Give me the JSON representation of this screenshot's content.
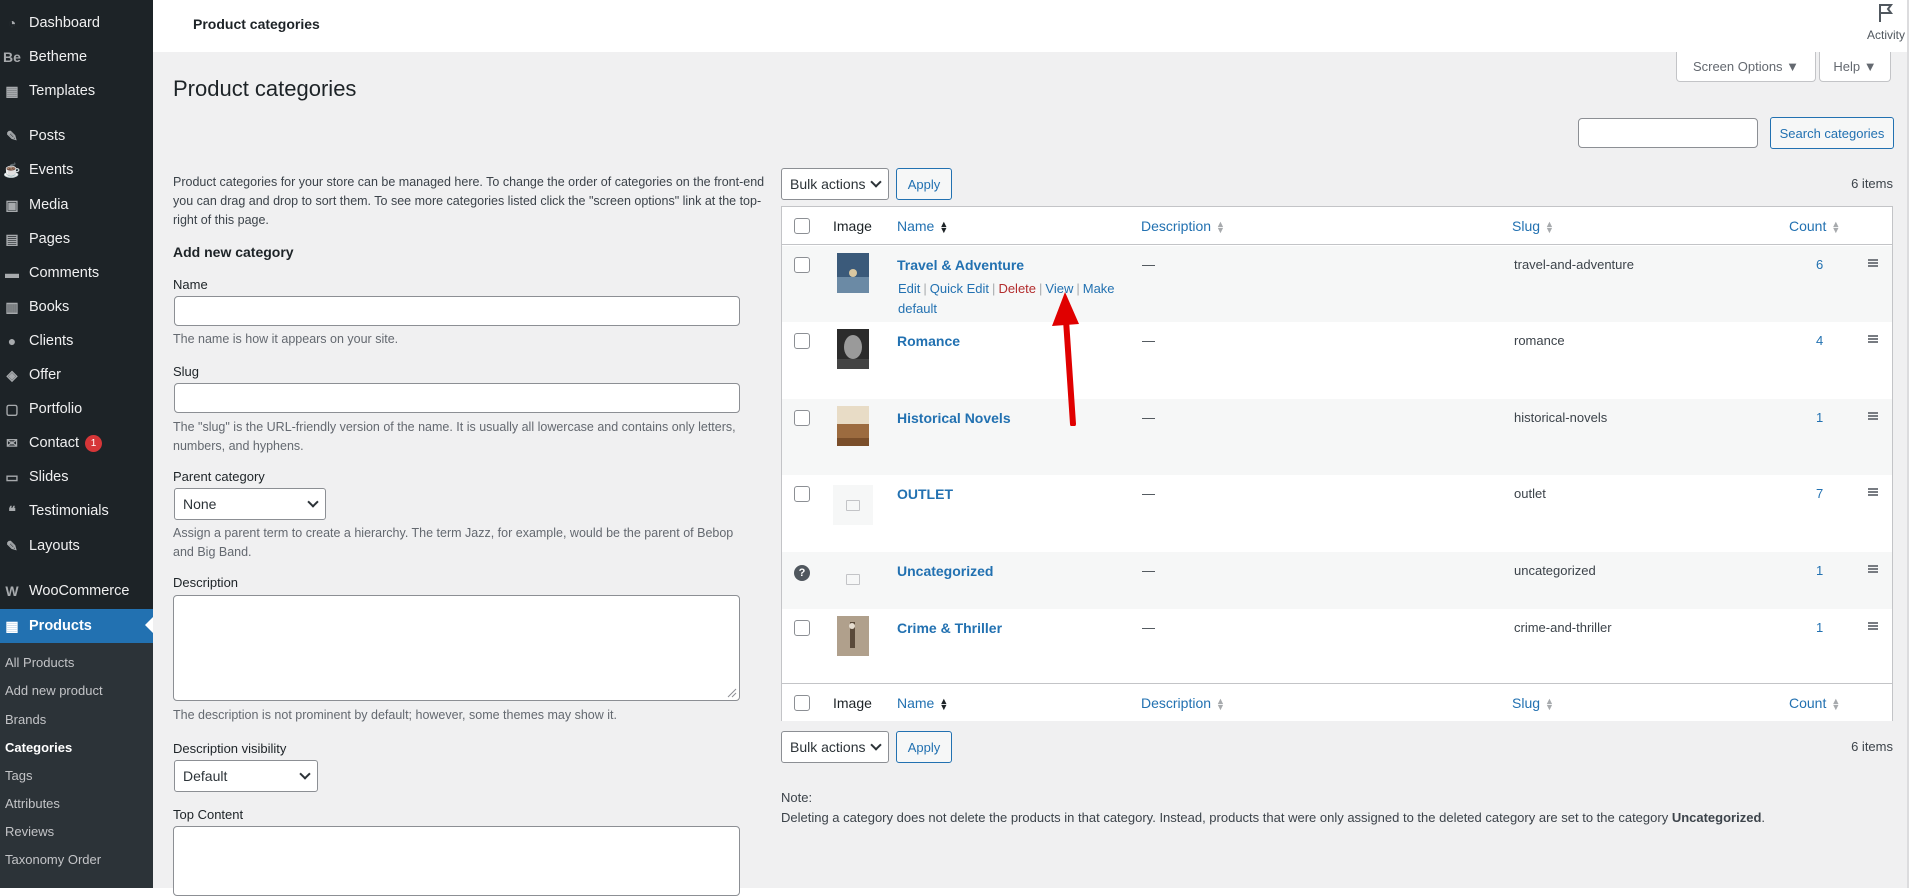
{
  "sidebar": {
    "items": [
      {
        "label": "Dashboard",
        "icon": "dashboard-icon"
      },
      {
        "label": "Betheme",
        "icon": "betheme-icon"
      },
      {
        "label": "Templates",
        "icon": "templates-icon"
      },
      {
        "label": "Posts",
        "icon": "pin-icon"
      },
      {
        "label": "Events",
        "icon": "events-icon"
      },
      {
        "label": "Media",
        "icon": "media-icon"
      },
      {
        "label": "Pages",
        "icon": "pages-icon"
      },
      {
        "label": "Comments",
        "icon": "comments-icon"
      },
      {
        "label": "Books",
        "icon": "books-icon"
      },
      {
        "label": "Clients",
        "icon": "clients-icon"
      },
      {
        "label": "Offer",
        "icon": "tag-icon"
      },
      {
        "label": "Portfolio",
        "icon": "portfolio-icon"
      },
      {
        "label": "Contact",
        "icon": "mail-icon",
        "badge": "1"
      },
      {
        "label": "Slides",
        "icon": "slides-icon"
      },
      {
        "label": "Testimonials",
        "icon": "testimonials-icon"
      },
      {
        "label": "Layouts",
        "icon": "layouts-icon"
      },
      {
        "label": "WooCommerce",
        "icon": "woocommerce-icon"
      },
      {
        "label": "Products",
        "icon": "products-icon"
      }
    ],
    "submenu": [
      "All Products",
      "Add new product",
      "Brands",
      "Categories",
      "Tags",
      "Attributes",
      "Reviews",
      "Taxonomy Order"
    ]
  },
  "header": {
    "title": "Product categories",
    "activity": "Activity",
    "screen_options": "Screen Options ▼",
    "help": "Help ▼"
  },
  "page": {
    "title": "Product categories",
    "search_button": "Search categories",
    "intro": "Product categories for your store can be managed here. To change the order of categories on the front-end you can drag and drop to sort them. To see more categories listed click the \"screen options\" link at the top-right of this page."
  },
  "form": {
    "heading": "Add new category",
    "name_label": "Name",
    "name_desc": "The name is how it appears on your site.",
    "slug_label": "Slug",
    "slug_desc": "The \"slug\" is the URL-friendly version of the name. It is usually all lowercase and contains only letters, numbers, and hyphens.",
    "parent_label": "Parent category",
    "parent_value": "None",
    "parent_desc": "Assign a parent term to create a hierarchy. The term Jazz, for example, would be the parent of Bebop and Big Band.",
    "description_label": "Description",
    "description_desc": "The description is not prominent by default; however, some themes may show it.",
    "visibility_label": "Description visibility",
    "visibility_value": "Default",
    "top_content_label": "Top Content"
  },
  "table": {
    "bulk_actions": "Bulk actions",
    "apply": "Apply",
    "items_count": "6 items",
    "columns": {
      "image": "Image",
      "name": "Name",
      "description": "Description",
      "slug": "Slug",
      "count": "Count"
    },
    "row_actions": {
      "edit": "Edit",
      "quick_edit": "Quick Edit",
      "delete": "Delete",
      "view": "View",
      "make_default_1": "Make",
      "make_default_2": "default"
    },
    "rows": [
      {
        "name": "Travel & Adventure",
        "description": "—",
        "slug": "travel-and-adventure",
        "count": "6"
      },
      {
        "name": "Romance",
        "description": "—",
        "slug": "romance",
        "count": "4"
      },
      {
        "name": "Historical Novels",
        "description": "—",
        "slug": "historical-novels",
        "count": "1"
      },
      {
        "name": "OUTLET",
        "description": "—",
        "slug": "outlet",
        "count": "7"
      },
      {
        "name": "Uncategorized",
        "description": "—",
        "slug": "uncategorized",
        "count": "1"
      },
      {
        "name": "Crime & Thriller",
        "description": "—",
        "slug": "crime-and-thriller",
        "count": "1"
      }
    ]
  },
  "note": {
    "label": "Note:",
    "text_before": "Deleting a category does not delete the products in that category. Instead, products that were only assigned to the deleted category are set to the category ",
    "text_bold": "Uncategorized",
    "text_after": "."
  },
  "colors": {
    "accent": "#2271b1",
    "sidebar": "#1d2327",
    "arrow": "#e00000"
  }
}
